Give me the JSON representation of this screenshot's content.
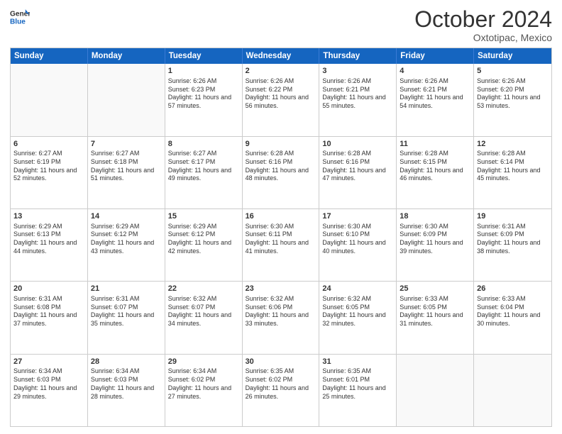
{
  "logo": {
    "line1": "General",
    "line2": "Blue"
  },
  "title": "October 2024",
  "subtitle": "Oxtotipac, Mexico",
  "header_days": [
    "Sunday",
    "Monday",
    "Tuesday",
    "Wednesday",
    "Thursday",
    "Friday",
    "Saturday"
  ],
  "rows": [
    [
      {
        "day": "",
        "sunrise": "",
        "sunset": "",
        "daylight": "",
        "empty": true
      },
      {
        "day": "",
        "sunrise": "",
        "sunset": "",
        "daylight": "",
        "empty": true
      },
      {
        "day": "1",
        "sunrise": "Sunrise: 6:26 AM",
        "sunset": "Sunset: 6:23 PM",
        "daylight": "Daylight: 11 hours and 57 minutes.",
        "empty": false
      },
      {
        "day": "2",
        "sunrise": "Sunrise: 6:26 AM",
        "sunset": "Sunset: 6:22 PM",
        "daylight": "Daylight: 11 hours and 56 minutes.",
        "empty": false
      },
      {
        "day": "3",
        "sunrise": "Sunrise: 6:26 AM",
        "sunset": "Sunset: 6:21 PM",
        "daylight": "Daylight: 11 hours and 55 minutes.",
        "empty": false
      },
      {
        "day": "4",
        "sunrise": "Sunrise: 6:26 AM",
        "sunset": "Sunset: 6:21 PM",
        "daylight": "Daylight: 11 hours and 54 minutes.",
        "empty": false
      },
      {
        "day": "5",
        "sunrise": "Sunrise: 6:26 AM",
        "sunset": "Sunset: 6:20 PM",
        "daylight": "Daylight: 11 hours and 53 minutes.",
        "empty": false
      }
    ],
    [
      {
        "day": "6",
        "sunrise": "Sunrise: 6:27 AM",
        "sunset": "Sunset: 6:19 PM",
        "daylight": "Daylight: 11 hours and 52 minutes.",
        "empty": false
      },
      {
        "day": "7",
        "sunrise": "Sunrise: 6:27 AM",
        "sunset": "Sunset: 6:18 PM",
        "daylight": "Daylight: 11 hours and 51 minutes.",
        "empty": false
      },
      {
        "day": "8",
        "sunrise": "Sunrise: 6:27 AM",
        "sunset": "Sunset: 6:17 PM",
        "daylight": "Daylight: 11 hours and 49 minutes.",
        "empty": false
      },
      {
        "day": "9",
        "sunrise": "Sunrise: 6:28 AM",
        "sunset": "Sunset: 6:16 PM",
        "daylight": "Daylight: 11 hours and 48 minutes.",
        "empty": false
      },
      {
        "day": "10",
        "sunrise": "Sunrise: 6:28 AM",
        "sunset": "Sunset: 6:16 PM",
        "daylight": "Daylight: 11 hours and 47 minutes.",
        "empty": false
      },
      {
        "day": "11",
        "sunrise": "Sunrise: 6:28 AM",
        "sunset": "Sunset: 6:15 PM",
        "daylight": "Daylight: 11 hours and 46 minutes.",
        "empty": false
      },
      {
        "day": "12",
        "sunrise": "Sunrise: 6:28 AM",
        "sunset": "Sunset: 6:14 PM",
        "daylight": "Daylight: 11 hours and 45 minutes.",
        "empty": false
      }
    ],
    [
      {
        "day": "13",
        "sunrise": "Sunrise: 6:29 AM",
        "sunset": "Sunset: 6:13 PM",
        "daylight": "Daylight: 11 hours and 44 minutes.",
        "empty": false
      },
      {
        "day": "14",
        "sunrise": "Sunrise: 6:29 AM",
        "sunset": "Sunset: 6:12 PM",
        "daylight": "Daylight: 11 hours and 43 minutes.",
        "empty": false
      },
      {
        "day": "15",
        "sunrise": "Sunrise: 6:29 AM",
        "sunset": "Sunset: 6:12 PM",
        "daylight": "Daylight: 11 hours and 42 minutes.",
        "empty": false
      },
      {
        "day": "16",
        "sunrise": "Sunrise: 6:30 AM",
        "sunset": "Sunset: 6:11 PM",
        "daylight": "Daylight: 11 hours and 41 minutes.",
        "empty": false
      },
      {
        "day": "17",
        "sunrise": "Sunrise: 6:30 AM",
        "sunset": "Sunset: 6:10 PM",
        "daylight": "Daylight: 11 hours and 40 minutes.",
        "empty": false
      },
      {
        "day": "18",
        "sunrise": "Sunrise: 6:30 AM",
        "sunset": "Sunset: 6:09 PM",
        "daylight": "Daylight: 11 hours and 39 minutes.",
        "empty": false
      },
      {
        "day": "19",
        "sunrise": "Sunrise: 6:31 AM",
        "sunset": "Sunset: 6:09 PM",
        "daylight": "Daylight: 11 hours and 38 minutes.",
        "empty": false
      }
    ],
    [
      {
        "day": "20",
        "sunrise": "Sunrise: 6:31 AM",
        "sunset": "Sunset: 6:08 PM",
        "daylight": "Daylight: 11 hours and 37 minutes.",
        "empty": false
      },
      {
        "day": "21",
        "sunrise": "Sunrise: 6:31 AM",
        "sunset": "Sunset: 6:07 PM",
        "daylight": "Daylight: 11 hours and 35 minutes.",
        "empty": false
      },
      {
        "day": "22",
        "sunrise": "Sunrise: 6:32 AM",
        "sunset": "Sunset: 6:07 PM",
        "daylight": "Daylight: 11 hours and 34 minutes.",
        "empty": false
      },
      {
        "day": "23",
        "sunrise": "Sunrise: 6:32 AM",
        "sunset": "Sunset: 6:06 PM",
        "daylight": "Daylight: 11 hours and 33 minutes.",
        "empty": false
      },
      {
        "day": "24",
        "sunrise": "Sunrise: 6:32 AM",
        "sunset": "Sunset: 6:05 PM",
        "daylight": "Daylight: 11 hours and 32 minutes.",
        "empty": false
      },
      {
        "day": "25",
        "sunrise": "Sunrise: 6:33 AM",
        "sunset": "Sunset: 6:05 PM",
        "daylight": "Daylight: 11 hours and 31 minutes.",
        "empty": false
      },
      {
        "day": "26",
        "sunrise": "Sunrise: 6:33 AM",
        "sunset": "Sunset: 6:04 PM",
        "daylight": "Daylight: 11 hours and 30 minutes.",
        "empty": false
      }
    ],
    [
      {
        "day": "27",
        "sunrise": "Sunrise: 6:34 AM",
        "sunset": "Sunset: 6:03 PM",
        "daylight": "Daylight: 11 hours and 29 minutes.",
        "empty": false
      },
      {
        "day": "28",
        "sunrise": "Sunrise: 6:34 AM",
        "sunset": "Sunset: 6:03 PM",
        "daylight": "Daylight: 11 hours and 28 minutes.",
        "empty": false
      },
      {
        "day": "29",
        "sunrise": "Sunrise: 6:34 AM",
        "sunset": "Sunset: 6:02 PM",
        "daylight": "Daylight: 11 hours and 27 minutes.",
        "empty": false
      },
      {
        "day": "30",
        "sunrise": "Sunrise: 6:35 AM",
        "sunset": "Sunset: 6:02 PM",
        "daylight": "Daylight: 11 hours and 26 minutes.",
        "empty": false
      },
      {
        "day": "31",
        "sunrise": "Sunrise: 6:35 AM",
        "sunset": "Sunset: 6:01 PM",
        "daylight": "Daylight: 11 hours and 25 minutes.",
        "empty": false
      },
      {
        "day": "",
        "sunrise": "",
        "sunset": "",
        "daylight": "",
        "empty": true
      },
      {
        "day": "",
        "sunrise": "",
        "sunset": "",
        "daylight": "",
        "empty": true
      }
    ]
  ]
}
